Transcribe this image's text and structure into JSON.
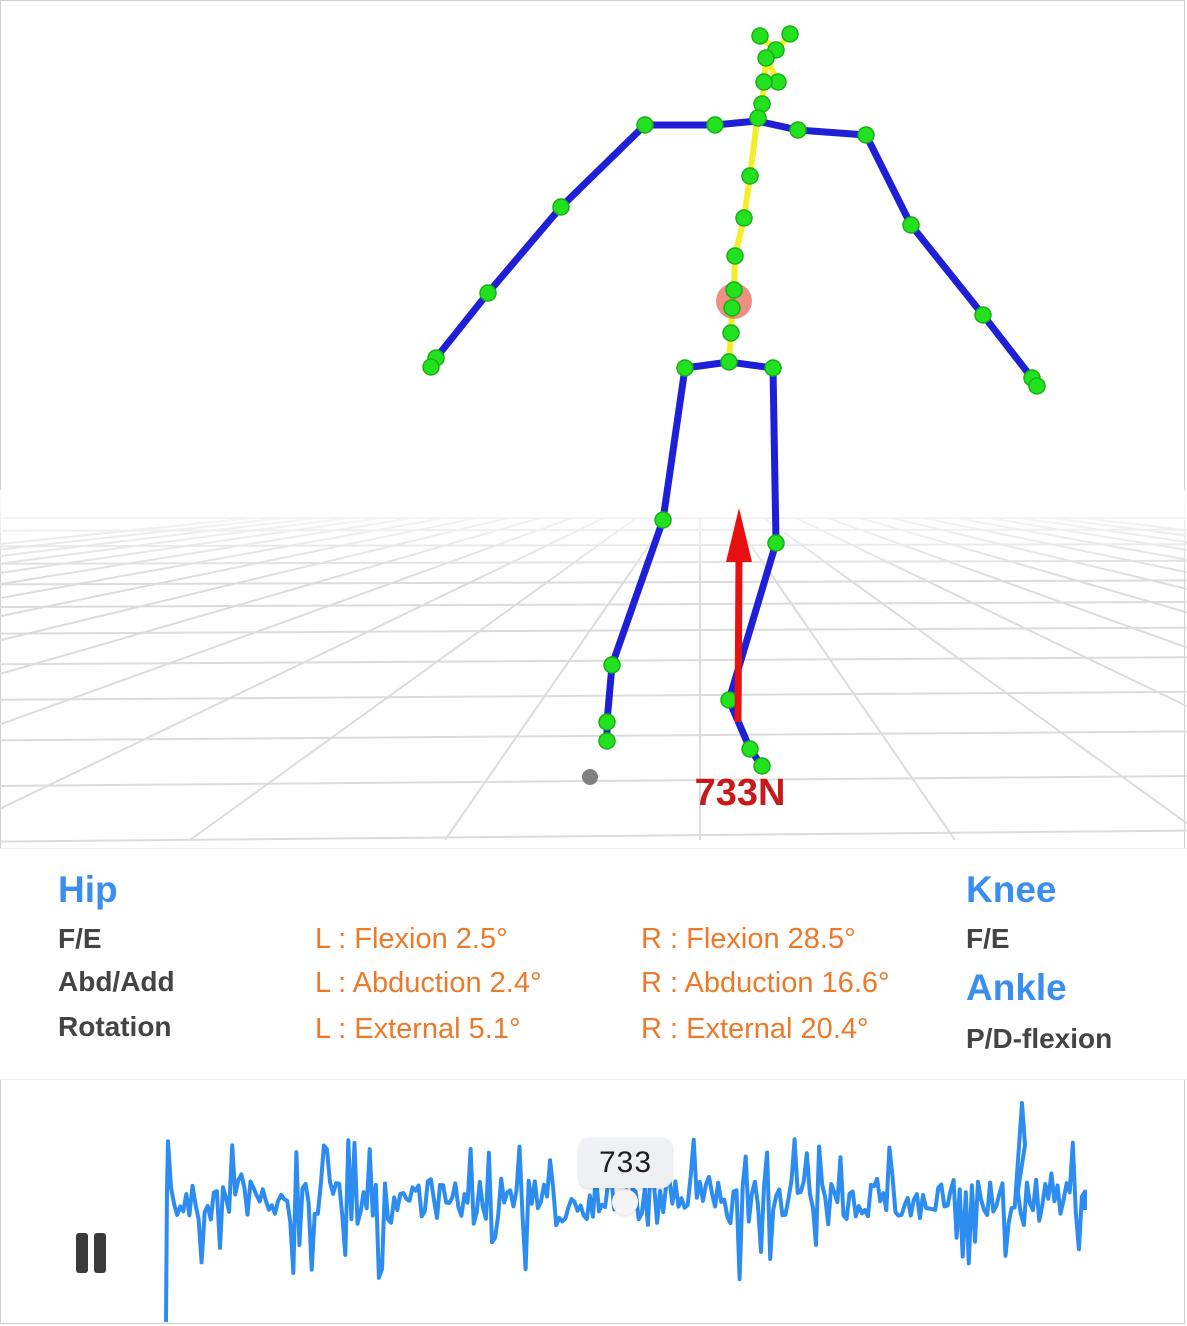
{
  "scene": {
    "force_label": "733N",
    "colors": {
      "bone": "#1f1fd8",
      "spine": "#f2ee2a",
      "joint": "#22e21f",
      "force": "#e81111",
      "com": "#e8604e"
    }
  },
  "hip": {
    "title": "Hip",
    "rows": [
      "F/E",
      "Abd/Add",
      "Rotation"
    ],
    "left": [
      "L : Flexion 2.5°",
      "L : Abduction 2.4°",
      "L : External 5.1°"
    ],
    "right": [
      "R : Flexion 28.5°",
      "R : Abduction 16.6°",
      "R : External 20.4°"
    ]
  },
  "knee": {
    "title": "Knee",
    "row": "F/E"
  },
  "ankle": {
    "title": "Ankle",
    "row": "P/D-flexion"
  },
  "graph": {
    "current_value": "733",
    "line_color": "#2d8cf0"
  }
}
